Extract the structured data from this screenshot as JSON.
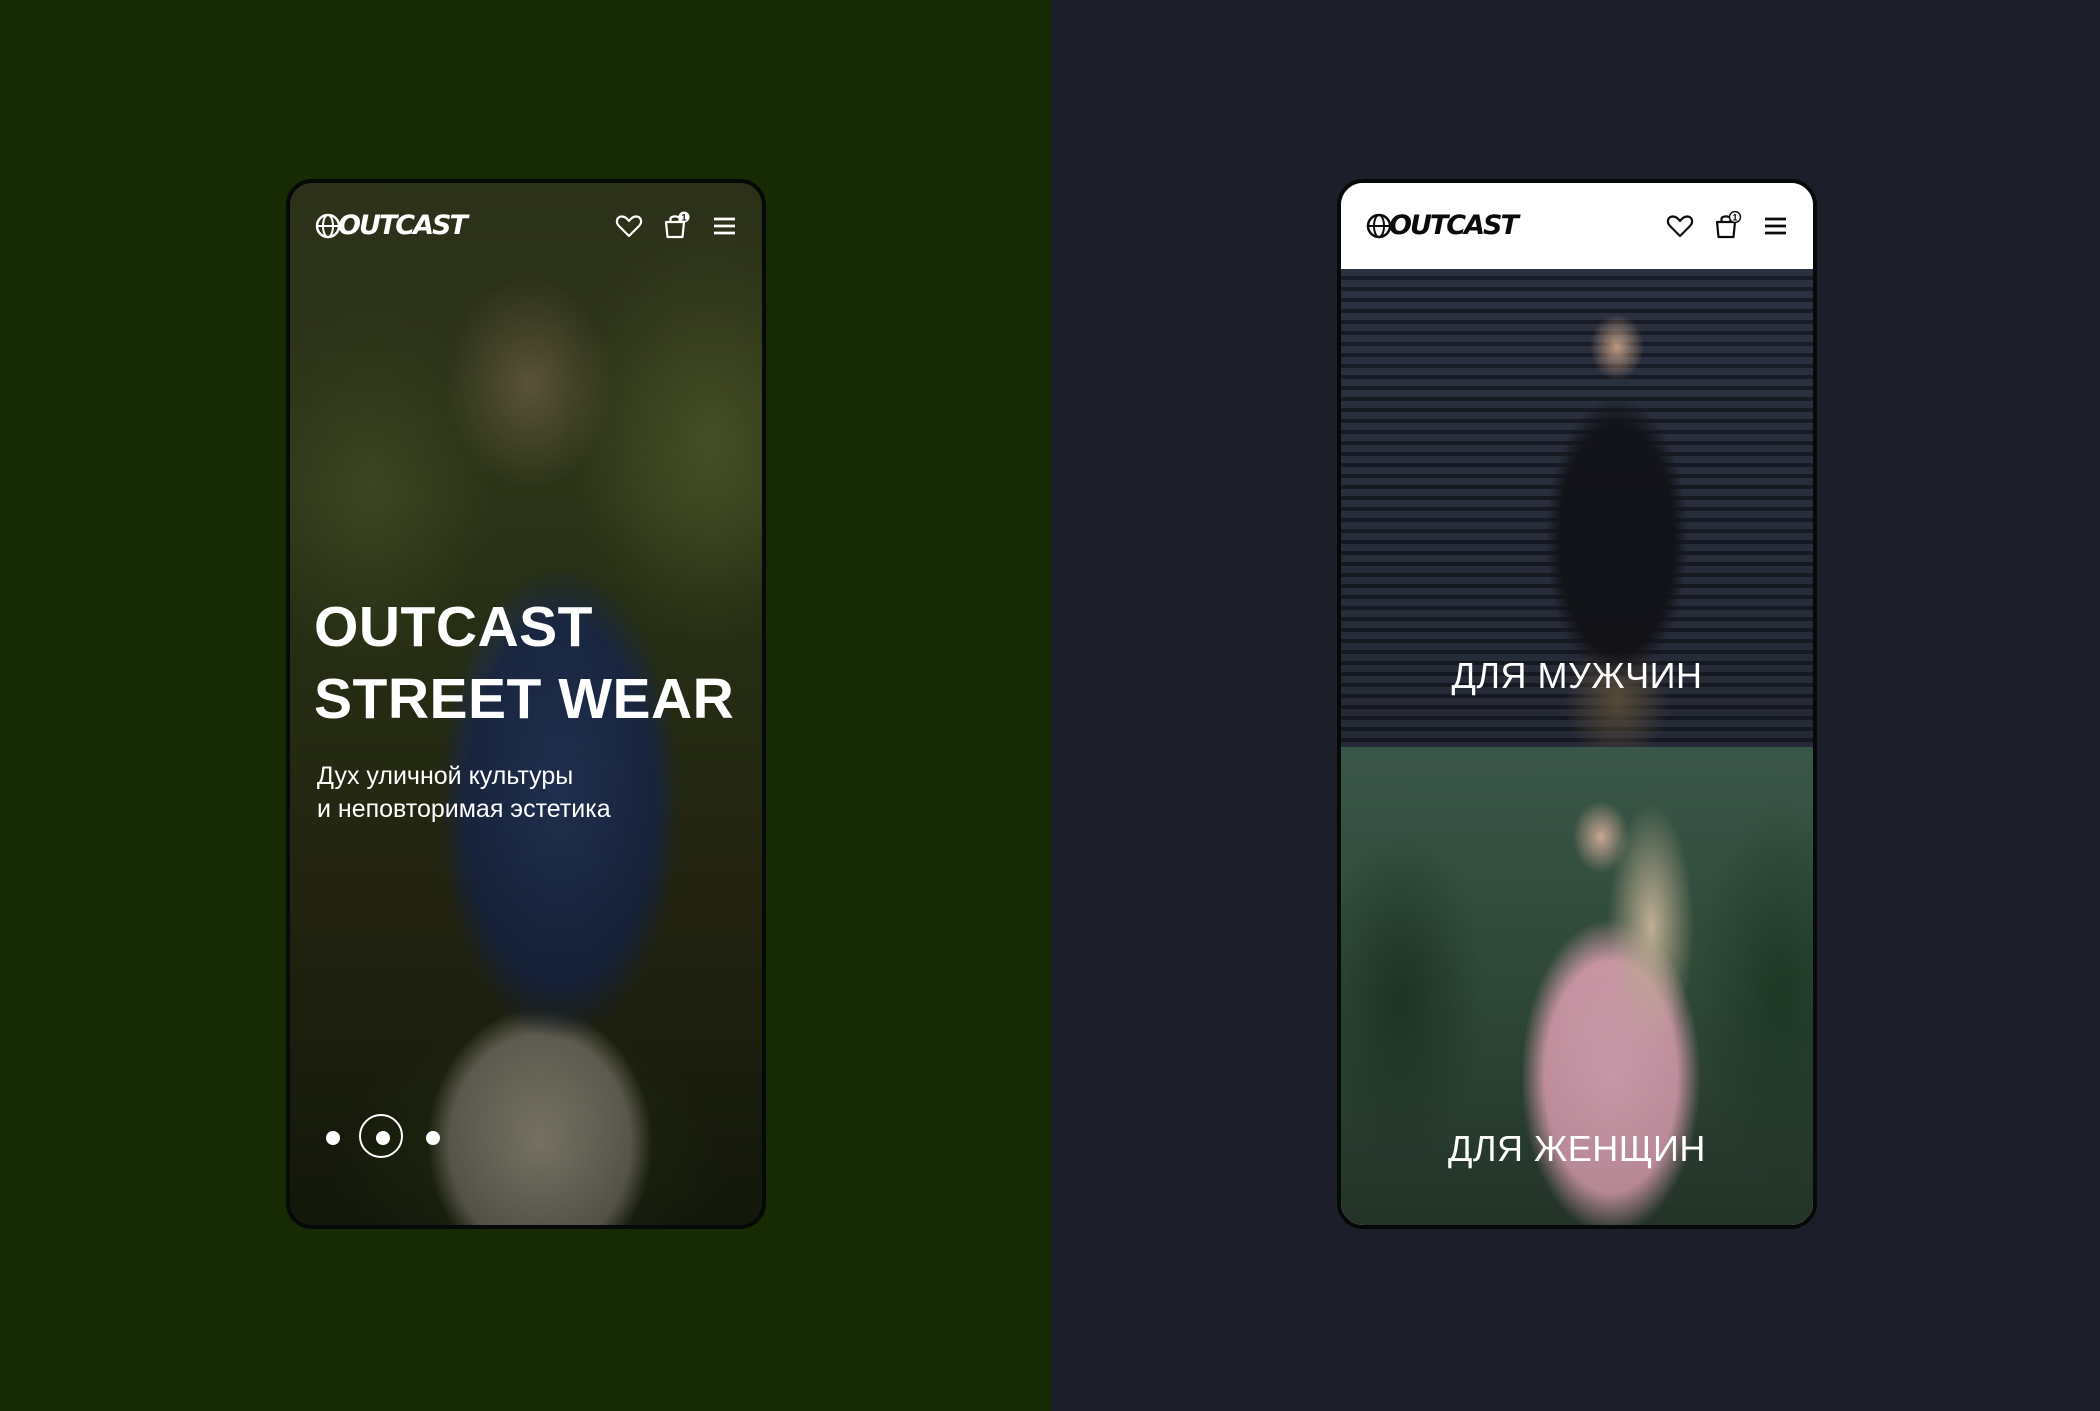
{
  "brand": {
    "logo_text": "OUTCAST"
  },
  "colors": {
    "left_background": "#162a04",
    "right_background": "#1c1f29",
    "text_light": "#ffffff",
    "text_dark": "#0b0b0b"
  },
  "header": {
    "icons": [
      "heart-icon",
      "shopping-bag-icon",
      "hamburger-menu-icon"
    ],
    "cart_count": "1"
  },
  "screen_home": {
    "hero_title_line1": "OUTCAST",
    "hero_title_line2": "STREET WEAR",
    "hero_subtitle_line1": "Дух уличной культуры",
    "hero_subtitle_line2": "и неповторимая эстетика",
    "slider": {
      "slides": 3,
      "active_index": 2
    }
  },
  "screen_categories": {
    "categories": [
      {
        "label": "ДЛЯ МУЖЧИН"
      },
      {
        "label": "ДЛЯ ЖЕНЩИН"
      }
    ]
  }
}
